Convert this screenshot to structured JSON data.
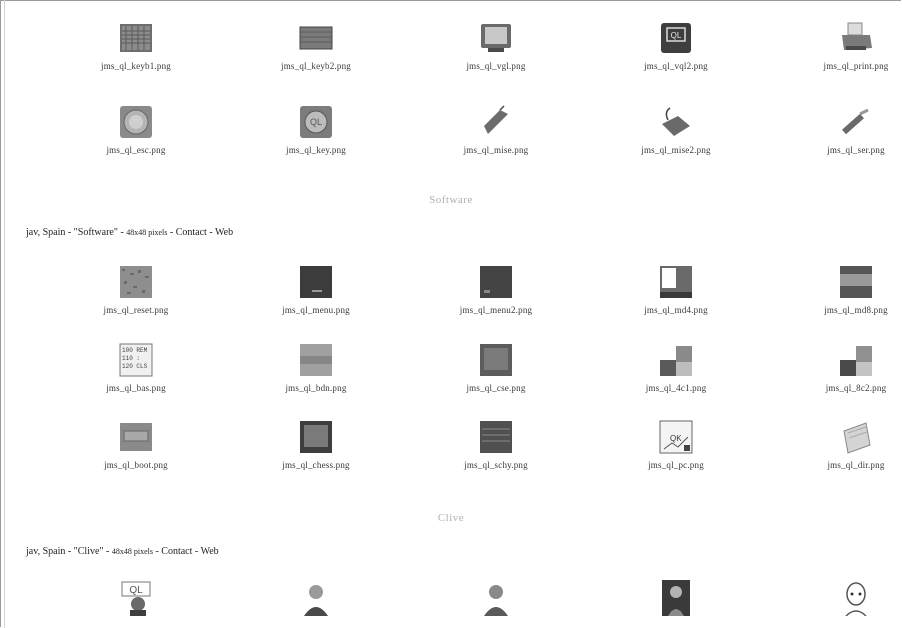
{
  "hardware": {
    "row1": [
      {
        "caption": "jms_ql_keyb1.png",
        "icon": "keyboard-icon"
      },
      {
        "caption": "jms_ql_keyb2.png",
        "icon": "keyboard-icon"
      },
      {
        "caption": "jms_ql_vgl.png",
        "icon": "monitor-icon"
      },
      {
        "caption": "jms_ql_vql2.png",
        "icon": "ql-box-icon"
      },
      {
        "caption": "jms_ql_print.png",
        "icon": "printer-icon"
      }
    ],
    "row2": [
      {
        "caption": "jms_ql_esc.png",
        "icon": "round-button-icon"
      },
      {
        "caption": "jms_ql_key.png",
        "icon": "ql-key-icon"
      },
      {
        "caption": "jms_ql_mise.png",
        "icon": "mouse-icon"
      },
      {
        "caption": "jms_ql_mise2.png",
        "icon": "mouse-icon"
      },
      {
        "caption": "jms_ql_ser.png",
        "icon": "cable-icon"
      }
    ]
  },
  "software": {
    "title": "Software",
    "credit": {
      "prefix": "jav, Spain - \"Software\" - ",
      "size": "48x48 pixels",
      "sep1": " - ",
      "contact": "Contact",
      "sep2": " - ",
      "web": "Web"
    },
    "row1": [
      {
        "caption": "jms_ql_reset.png",
        "icon": "noise-screen-icon"
      },
      {
        "caption": "jms_ql_menu.png",
        "icon": "dark-screen-icon"
      },
      {
        "caption": "jms_ql_menu2.png",
        "icon": "dark-screen-icon"
      },
      {
        "caption": "jms_ql_md4.png",
        "icon": "split-screen-icon"
      },
      {
        "caption": "jms_ql_md8.png",
        "icon": "band-screen-icon"
      }
    ],
    "row2": [
      {
        "caption": "jms_ql_bas.png",
        "icon": "basic-screen-icon"
      },
      {
        "caption": "jms_ql_bdn.png",
        "icon": "gray-screen-icon"
      },
      {
        "caption": "jms_ql_cse.png",
        "icon": "dark-screen-icon"
      },
      {
        "caption": "jms_ql_4c1.png",
        "icon": "color-blocks-icon"
      },
      {
        "caption": "jms_ql_8c2.png",
        "icon": "color-blocks-icon"
      }
    ],
    "row3": [
      {
        "caption": "jms_ql_boot.png",
        "icon": "boot-screen-icon"
      },
      {
        "caption": "jms_ql_chess.png",
        "icon": "chess-screen-icon"
      },
      {
        "caption": "jms_ql_schy.png",
        "icon": "dark-screen-icon"
      },
      {
        "caption": "jms_ql_pc.png",
        "icon": "pc-doc-icon"
      },
      {
        "caption": "jms_ql_dir.png",
        "icon": "folder-icon"
      }
    ]
  },
  "clive": {
    "title": "Clive",
    "credit": {
      "prefix": "jav, Spain - \"Clive\" - ",
      "size": "48x48 pixels",
      "sep1": " - ",
      "contact": "Contact",
      "sep2": " - ",
      "web": "Web"
    },
    "row1": [
      {
        "caption": "",
        "icon": "ql-logo-portrait-icon"
      },
      {
        "caption": "",
        "icon": "portrait-icon"
      },
      {
        "caption": "",
        "icon": "portrait-icon"
      },
      {
        "caption": "",
        "icon": "dark-portrait-icon"
      },
      {
        "caption": "",
        "icon": "bald-portrait-icon"
      }
    ]
  }
}
